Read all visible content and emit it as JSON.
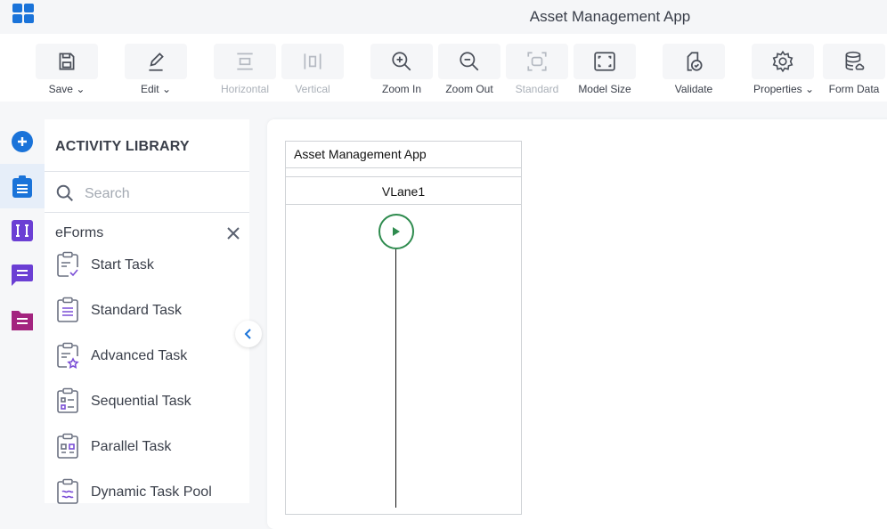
{
  "app": {
    "title": "Asset Management App"
  },
  "toolbar": {
    "buttons": [
      {
        "label": "Save",
        "icon": "save-icon",
        "dropdown": true,
        "enabled": true
      },
      {
        "label": "Edit",
        "icon": "edit-icon",
        "dropdown": true,
        "enabled": true
      },
      {
        "label": "Horizontal",
        "icon": "horizontal-icon",
        "enabled": false
      },
      {
        "label": "Vertical",
        "icon": "vertical-icon",
        "enabled": false
      },
      {
        "label": "Zoom In",
        "icon": "zoom-in-icon",
        "enabled": true
      },
      {
        "label": "Zoom Out",
        "icon": "zoom-out-icon",
        "enabled": true
      },
      {
        "label": "Standard",
        "icon": "standard-icon",
        "enabled": false
      },
      {
        "label": "Model Size",
        "icon": "model-size-icon",
        "enabled": true
      },
      {
        "label": "Validate",
        "icon": "validate-icon",
        "enabled": true
      },
      {
        "label": "Properties",
        "icon": "gear-icon",
        "dropdown": true,
        "enabled": true
      },
      {
        "label": "Form Data",
        "icon": "database-icon",
        "enabled": true
      }
    ]
  },
  "rail": {
    "items": [
      {
        "name": "add",
        "icon": "plus-circle-icon",
        "color": "#1a73d9"
      },
      {
        "name": "activity-library",
        "icon": "clipboard-icon",
        "color": "#1a73d9",
        "active": true
      },
      {
        "name": "text-field",
        "icon": "text-field-icon",
        "color": "#6b3fd4"
      },
      {
        "name": "comments",
        "icon": "chat-icon",
        "color": "#6b3fd4"
      },
      {
        "name": "documents",
        "icon": "folder-icon",
        "color": "#a3247f"
      }
    ]
  },
  "library": {
    "title": "ACTIVITY LIBRARY",
    "search_placeholder": "Search",
    "category": "eForms",
    "items": [
      {
        "label": "Start Task",
        "icon": "start-task-icon"
      },
      {
        "label": "Standard Task",
        "icon": "standard-task-icon"
      },
      {
        "label": "Advanced Task",
        "icon": "advanced-task-icon"
      },
      {
        "label": "Sequential Task",
        "icon": "sequential-task-icon"
      },
      {
        "label": "Parallel Task",
        "icon": "parallel-task-icon"
      },
      {
        "label": "Dynamic Task Pool",
        "icon": "dynamic-task-pool-icon"
      }
    ]
  },
  "canvas": {
    "pool_title": "Asset Management App",
    "lane_title": "VLane1"
  },
  "colors": {
    "accent": "#1a73d9",
    "purple": "#6b3fd4",
    "start_event": "#2e8b4e"
  }
}
